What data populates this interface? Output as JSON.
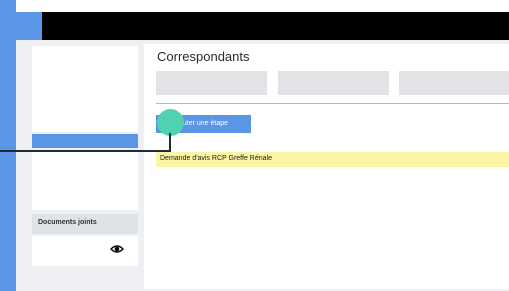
{
  "header": {
    "title": "Correspondants"
  },
  "sidebar": {
    "documents_title": "Documents joints"
  },
  "actions": {
    "add_step_label": "outer une étape"
  },
  "steps": [
    {
      "label": "Demande d'avis RCP Greffe Rénale"
    }
  ],
  "colors": {
    "accent": "#5b95e6",
    "highlight": "#4fd1b2",
    "step_row": "#fbf6a3",
    "topbar": "#000000"
  },
  "icons": {
    "documents_view": "eye-icon"
  }
}
